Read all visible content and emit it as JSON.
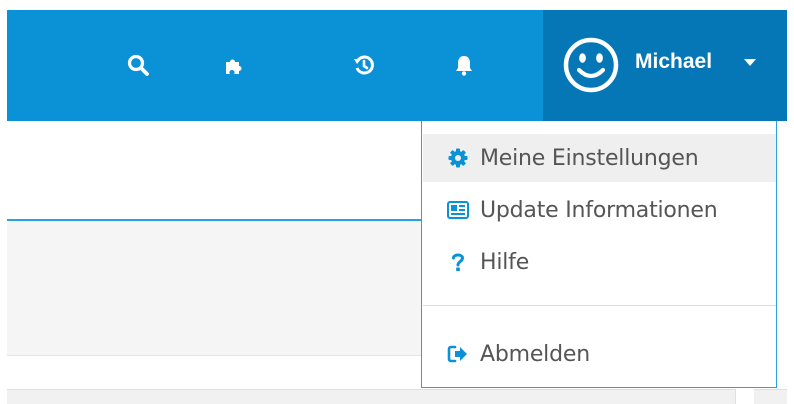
{
  "header": {
    "bg_color": "#0a91d6",
    "user_bg_color": "#0677b6",
    "icons": [
      {
        "name": "search-icon"
      },
      {
        "name": "puzzle-icon"
      },
      {
        "name": "history-icon"
      },
      {
        "name": "bell-icon"
      }
    ],
    "user": {
      "name": "Michael",
      "avatar_icon": "smiley-icon",
      "caret_icon": "caret-down-icon"
    }
  },
  "dropdown": {
    "border_color": "#29a3de",
    "icon_color": "#0a91d6",
    "items": [
      {
        "label": "Meine Einstellungen",
        "icon": "gear-icon",
        "active": true
      },
      {
        "label": "Update Informationen",
        "icon": "newspaper-icon",
        "active": false
      },
      {
        "label": "Hilfe",
        "icon": "question-icon",
        "active": false
      },
      {
        "label": "Abmelden",
        "icon": "sign-out-icon",
        "active": false
      }
    ]
  }
}
